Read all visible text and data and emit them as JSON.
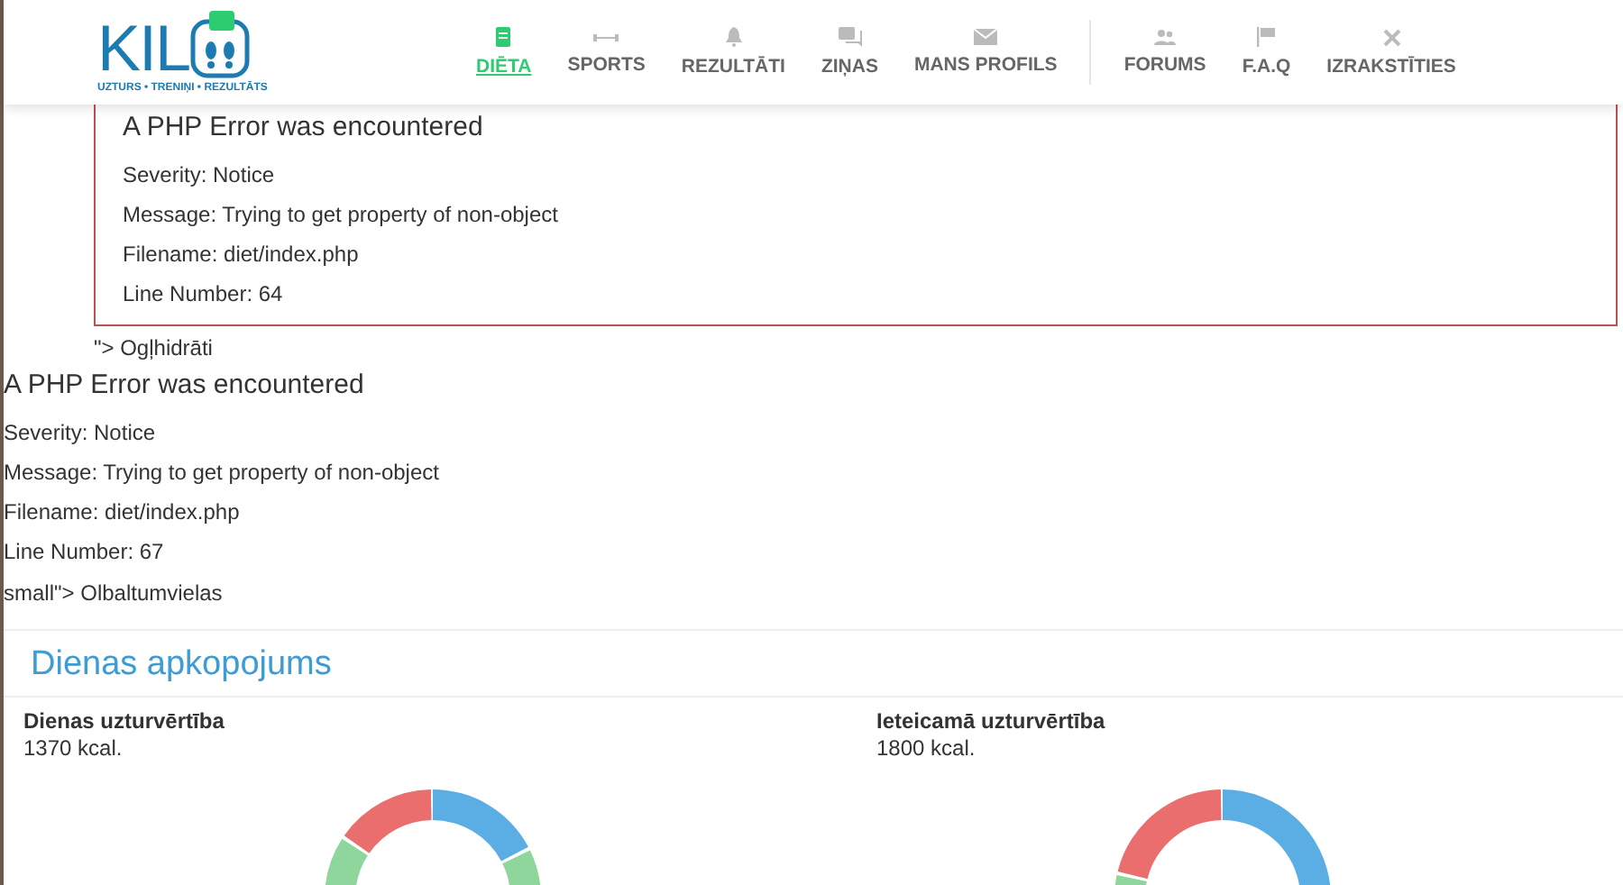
{
  "header": {
    "logo": {
      "word": "KIL",
      "tagline": "UZTURS • TRENIŅI • REZULTĀTS"
    },
    "nav": [
      {
        "label": "DIĒTA",
        "selected": true
      },
      {
        "label": "SPORTS",
        "selected": false
      },
      {
        "label": "REZULTĀTI",
        "selected": false
      },
      {
        "label": "ZIŅAS",
        "selected": false
      },
      {
        "label": "MANS PROFILS",
        "selected": false
      }
    ],
    "nav_secondary": [
      {
        "label": "FORUMS",
        "selected": false
      },
      {
        "label": "F.A.Q",
        "selected": false
      },
      {
        "label": "IZRAKSTĪTIES",
        "selected": false
      }
    ]
  },
  "boxed_error": {
    "title": "A PHP Error was encountered",
    "lines": [
      "Severity: Notice",
      "Message: Trying to get property of non-object",
      "Filename: diet/index.php",
      "Line Number: 64"
    ]
  },
  "stray_text_1": "\"> Ogļhidrāti",
  "plain_error": {
    "title": "A PHP Error was encountered",
    "lines": [
      "Severity: Notice",
      "Message: Trying to get property of non-object",
      "Filename: diet/index.php",
      "Line Number: 67"
    ]
  },
  "stray_text_2": "small\"> Olbaltumvielas",
  "summary": {
    "title": "Dienas apkopojums",
    "columns": [
      {
        "label": "Dienas uzturvērtība",
        "value": "1370 kcal."
      },
      {
        "label": "Ieteicamā uzturvērtība",
        "value": "1800 kcal."
      }
    ]
  }
}
